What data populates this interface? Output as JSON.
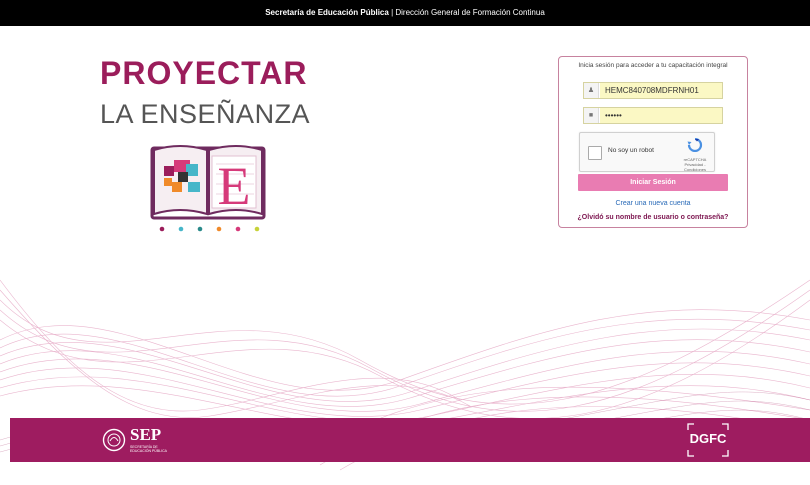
{
  "header": {
    "org": "Secretaría de Educación Pública",
    "separator": "|",
    "dept": "Dirección General de Formación Continua"
  },
  "brand": {
    "line1": "PROYECTAR",
    "line2": "LA ENSEÑANZA",
    "book_letter": "E"
  },
  "login": {
    "title": "Inicia sesión para acceder a tu capacitación integral",
    "username": {
      "value": "HEMC840708MDFRNH01",
      "icon": "user-icon"
    },
    "password": {
      "value": "••••••",
      "icon": "lock-icon"
    },
    "captcha": {
      "label": "No soy un robot",
      "brand": "reCAPTCHA",
      "links": "Privacidad - Condiciones"
    },
    "submit_label": "Iniciar Sesión",
    "create_account": "Crear una nueva cuenta",
    "forgot": "¿Olvidó su nombre de usuario o contraseña?"
  },
  "footer": {
    "sep_logo": "SEP",
    "sep_sub1": "SECRETARÍA DE",
    "sep_sub2": "EDUCACIÓN PÚBLICA",
    "dgfc_logo": "DGFC"
  },
  "colors": {
    "brand_magenta": "#9b1d5b",
    "footer": "#9e1c60",
    "button": "#e97cb2",
    "link": "#2a6bb8",
    "dots": [
      "#9b1d5b",
      "#46b6c9",
      "#2a8a8a",
      "#f08a2a",
      "#d63a7a",
      "#c7d23a"
    ]
  }
}
